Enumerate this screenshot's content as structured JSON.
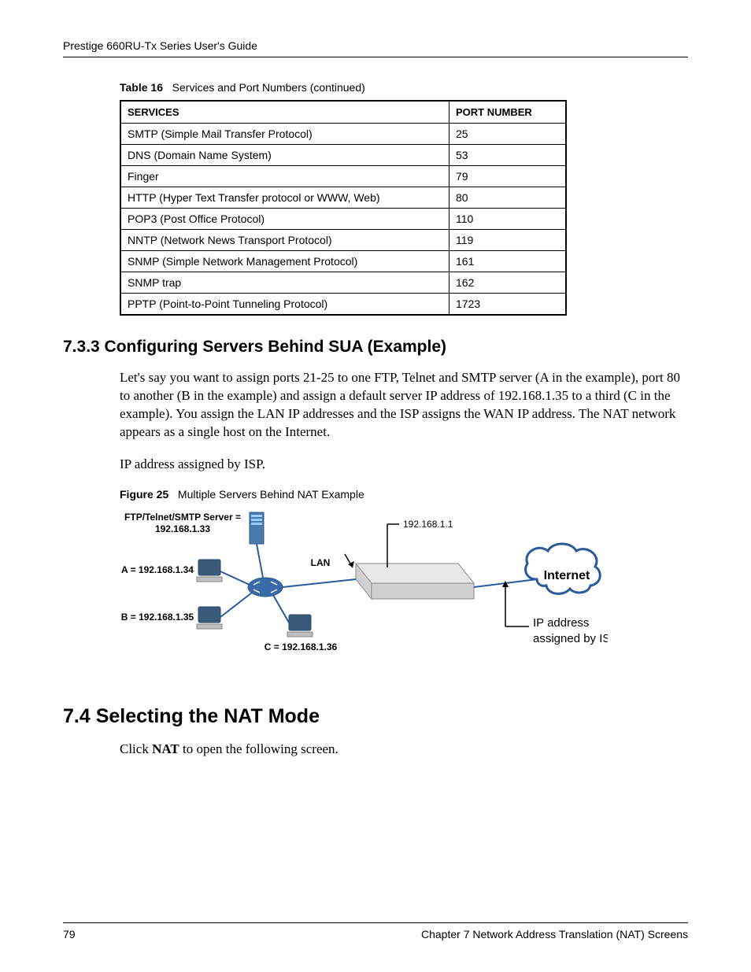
{
  "header": "Prestige 660RU-Tx Series User's Guide",
  "table": {
    "label": "Table 16",
    "caption": "Services and Port Numbers (continued)",
    "col_services": "SERVICES",
    "col_port": "PORT NUMBER",
    "rows": [
      {
        "s": "SMTP (Simple Mail Transfer Protocol)",
        "p": "25"
      },
      {
        "s": "DNS (Domain Name System)",
        "p": "53"
      },
      {
        "s": "Finger",
        "p": "79"
      },
      {
        "s": "HTTP (Hyper Text Transfer protocol or WWW, Web)",
        "p": "80"
      },
      {
        "s": "POP3 (Post Office Protocol)",
        "p": "110"
      },
      {
        "s": "NNTP (Network News Transport Protocol)",
        "p": "119"
      },
      {
        "s": "SNMP (Simple Network Management Protocol)",
        "p": "161"
      },
      {
        "s": "SNMP trap",
        "p": "162"
      },
      {
        "s": "PPTP (Point-to-Point Tunneling Protocol)",
        "p": "1723"
      }
    ]
  },
  "sec733": {
    "title": "7.3.3  Configuring Servers Behind SUA (Example)",
    "para1": "Let's say you want to assign ports 21-25 to one FTP, Telnet and SMTP server (A in the example), port 80 to another (B in the example) and assign a default server IP address of 192.168.1.35 to a third (C in the example). You assign the LAN IP addresses and the ISP assigns the WAN IP address. The NAT network appears as a single host on the Internet.",
    "para2": "IP address assigned by ISP."
  },
  "figure25": {
    "label": "Figure 25",
    "caption": "Multiple Servers Behind NAT Example",
    "server_text_l1": "FTP/Telnet/SMTP Server =",
    "server_text_l2": "192.168.1.33",
    "host_a": "A = 192.168.1.34",
    "host_b": "B = 192.168.1.35",
    "host_c": "C = 192.168.1.36",
    "router_ip": "192.168.1.1",
    "lan": "LAN",
    "internet": "Internet",
    "isp_l1": "IP address",
    "isp_l2": "assigned by ISP."
  },
  "sec74": {
    "title": "7.4  Selecting the NAT Mode",
    "para_pre": "Click ",
    "para_bold": "NAT",
    "para_post": " to open the following screen."
  },
  "footer": {
    "page": "79",
    "chapter": "Chapter 7 Network Address Translation (NAT) Screens"
  }
}
